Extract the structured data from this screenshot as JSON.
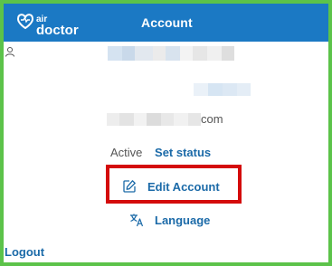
{
  "header": {
    "brand_top": "air",
    "brand_bottom": "doctor",
    "title": "Account"
  },
  "profile": {
    "email_suffix": "com",
    "status": "Active",
    "set_status_label": "Set status"
  },
  "menu": {
    "edit_account_label": "Edit Account",
    "language_label": "Language"
  },
  "footer": {
    "logout_label": "Logout"
  },
  "colors": {
    "header_bg": "#1b79c4",
    "link": "#1b6aa8",
    "highlight": "#d40b0b",
    "frame": "#5cc34a"
  },
  "icons": {
    "user": "user-icon",
    "edit": "edit-icon",
    "language": "translate-icon",
    "logo": "heart-logo-icon"
  }
}
